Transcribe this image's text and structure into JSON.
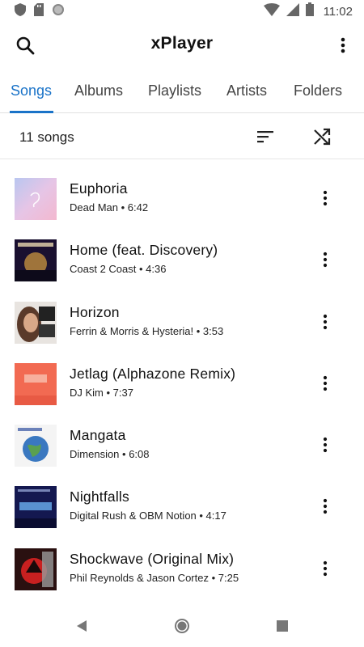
{
  "status_bar": {
    "time": "11:02",
    "icons": [
      "shield-icon",
      "sd-card-icon",
      "sync-icon",
      "wifi-icon",
      "signal-icon",
      "battery-icon"
    ]
  },
  "app_bar": {
    "title": "xPlayer",
    "search_icon": "search-icon",
    "menu_icon": "more-vertical-icon"
  },
  "tabs": [
    {
      "label": "Songs",
      "active": true
    },
    {
      "label": "Albums",
      "active": false
    },
    {
      "label": "Playlists",
      "active": false
    },
    {
      "label": "Artists",
      "active": false
    },
    {
      "label": "Folders",
      "active": false
    }
  ],
  "toolbar": {
    "count_label": "11 songs",
    "sort_icon": "sort-icon",
    "shuffle_icon": "shuffle-icon"
  },
  "songs": [
    {
      "title": "Euphoria",
      "subtitle": "Dead Man • 6:42"
    },
    {
      "title": "Home (feat. Discovery)",
      "subtitle": "Coast 2 Coast • 4:36"
    },
    {
      "title": "Horizon",
      "subtitle": "Ferrin & Morris & Hysteria! • 3:53"
    },
    {
      "title": "Jetlag (Alphazone Remix)",
      "subtitle": "DJ Kim • 7:37"
    },
    {
      "title": "Mangata",
      "subtitle": "Dimension • 6:08"
    },
    {
      "title": "Nightfalls",
      "subtitle": "Digital Rush & OBM Notion • 4:17"
    },
    {
      "title": "Shockwave (Original Mix)",
      "subtitle": "Phil Reynolds & Jason Cortez • 7:25"
    }
  ],
  "nav_bar": {
    "back_icon": "back-icon",
    "home_icon": "home-icon",
    "recents_icon": "recents-icon"
  },
  "colors": {
    "accent": "#1a73c8"
  }
}
